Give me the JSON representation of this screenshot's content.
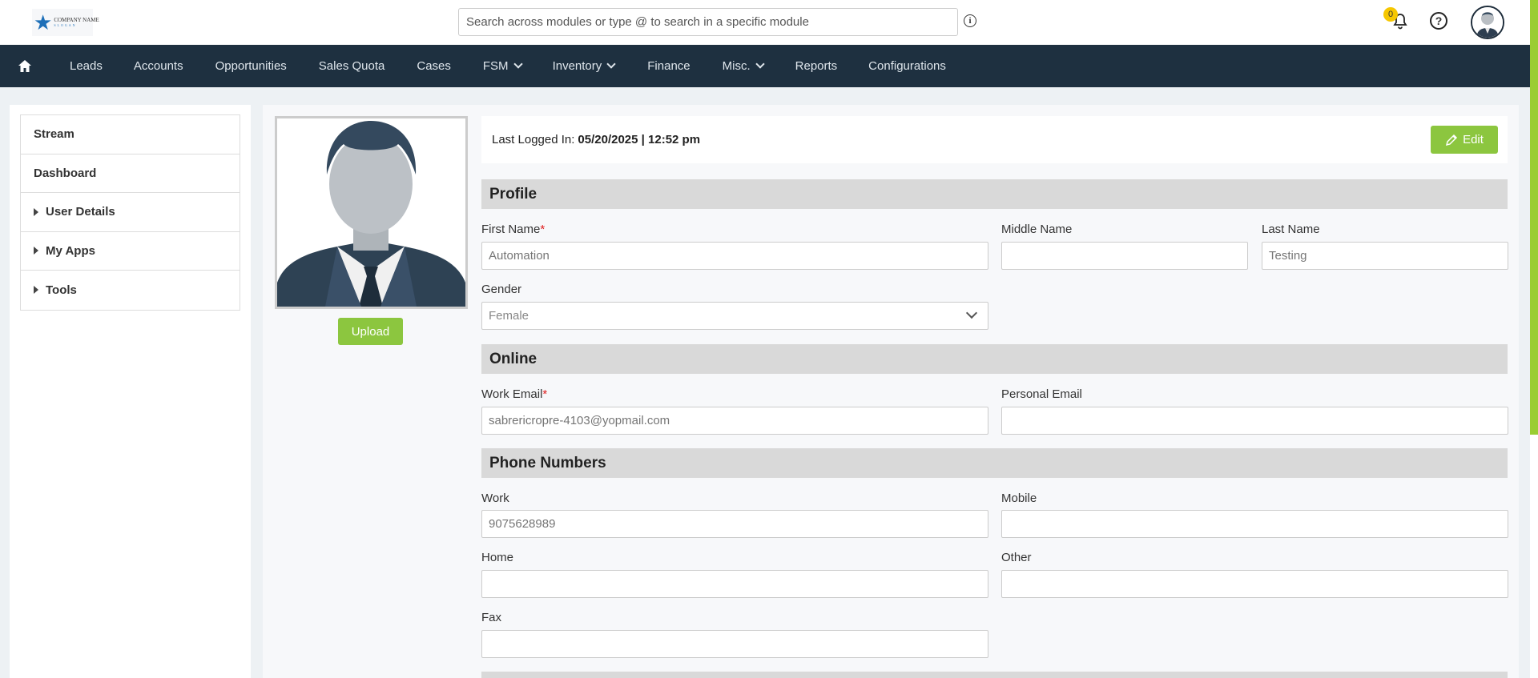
{
  "header": {
    "logo": {
      "text": "COMPANY NAME",
      "tagline": "SLOGAN"
    },
    "search_placeholder": "Search across modules or type @ to search in a specific module",
    "notification_count": "0",
    "help_glyph": "?",
    "info_glyph": "i"
  },
  "nav": {
    "items": [
      {
        "label": "Leads"
      },
      {
        "label": "Accounts"
      },
      {
        "label": "Opportunities"
      },
      {
        "label": "Sales Quota"
      },
      {
        "label": "Cases"
      },
      {
        "label": "FSM"
      },
      {
        "label": "Inventory"
      },
      {
        "label": "Finance"
      },
      {
        "label": "Misc."
      },
      {
        "label": "Reports"
      },
      {
        "label": "Configurations"
      }
    ]
  },
  "sidebar": {
    "items": [
      {
        "label": "Stream"
      },
      {
        "label": "Dashboard"
      },
      {
        "label": "User Details"
      },
      {
        "label": "My Apps"
      },
      {
        "label": "Tools"
      }
    ]
  },
  "profile_photo": {
    "upload_label": "Upload"
  },
  "login_info": {
    "label": "Last Logged In:",
    "value": "05/20/2025 | 12:52 pm"
  },
  "edit_label": "Edit",
  "sections": {
    "profile": {
      "title": "Profile",
      "first_name": {
        "label": "First Name",
        "placeholder": "Automation"
      },
      "middle_name": {
        "label": "Middle Name",
        "placeholder": ""
      },
      "last_name": {
        "label": "Last Name",
        "placeholder": "Testing"
      },
      "gender": {
        "label": "Gender",
        "value": "Female"
      }
    },
    "online": {
      "title": "Online",
      "work_email": {
        "label": "Work Email",
        "placeholder": "sabrericropre-4103@yopmail.com"
      },
      "personal_email": {
        "label": "Personal Email",
        "placeholder": ""
      }
    },
    "phone": {
      "title": "Phone Numbers",
      "work": {
        "label": "Work",
        "placeholder": "9075628989"
      },
      "mobile": {
        "label": "Mobile",
        "placeholder": ""
      },
      "home": {
        "label": "Home",
        "placeholder": ""
      },
      "other": {
        "label": "Other",
        "placeholder": ""
      },
      "fax": {
        "label": "Fax",
        "placeholder": ""
      }
    }
  },
  "required_mark": "*",
  "colors": {
    "nav_bg": "#1e3040",
    "accent_green": "#8cc63f",
    "badge": "#f6c700"
  }
}
